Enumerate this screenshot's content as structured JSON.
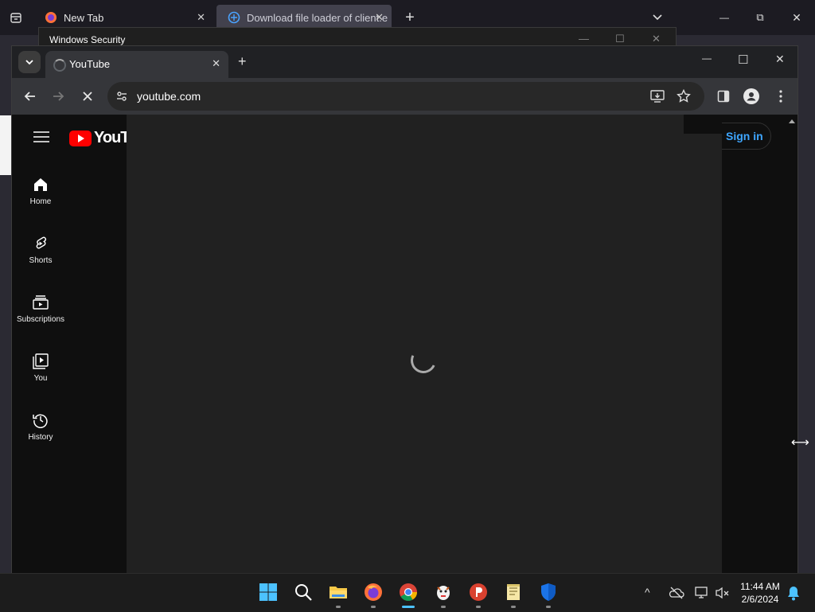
{
  "firefox": {
    "tabs": [
      {
        "title": "New Tab",
        "close": "✕"
      },
      {
        "title": "Download file loader of client.e",
        "close": "✕"
      }
    ],
    "new_tab": "+",
    "list_tabs": "⌄",
    "window_controls": {
      "minimize": "—",
      "maximize": "⧉",
      "close": "✕"
    }
  },
  "windows_security": {
    "title": "Windows Security",
    "controls": {
      "minimize": "—",
      "maximize": "☐",
      "close": "✕"
    }
  },
  "chrome": {
    "tab": {
      "title": "YouTube",
      "close": "✕"
    },
    "new_tab": "+",
    "window_controls": {
      "minimize": "—",
      "maximize": "☐",
      "close": "✕"
    },
    "address": "youtube.com",
    "colors": {
      "tabstrip": "#202124",
      "toolbar": "#35363a"
    }
  },
  "youtube": {
    "logo_text": "YouTu",
    "nav": [
      {
        "label": "Home",
        "icon": "home-icon"
      },
      {
        "label": "Shorts",
        "icon": "shorts-icon"
      },
      {
        "label": "Subscriptions",
        "icon": "subscriptions-icon"
      },
      {
        "label": "You",
        "icon": "you-icon"
      },
      {
        "label": "History",
        "icon": "history-icon"
      }
    ],
    "sign_in": "Sign in",
    "colors": {
      "brand": "#ff0000",
      "link": "#3ea6ff"
    }
  },
  "taskbar": {
    "time": "11:44 AM",
    "date": "2/6/2024",
    "apps": [
      "start-icon",
      "search-icon",
      "file-explorer-icon",
      "firefox-icon",
      "chrome-icon",
      "app-mascot-icon",
      "psiphon-icon",
      "notepad-icon",
      "defender-icon"
    ],
    "tray_overflow": "^"
  }
}
